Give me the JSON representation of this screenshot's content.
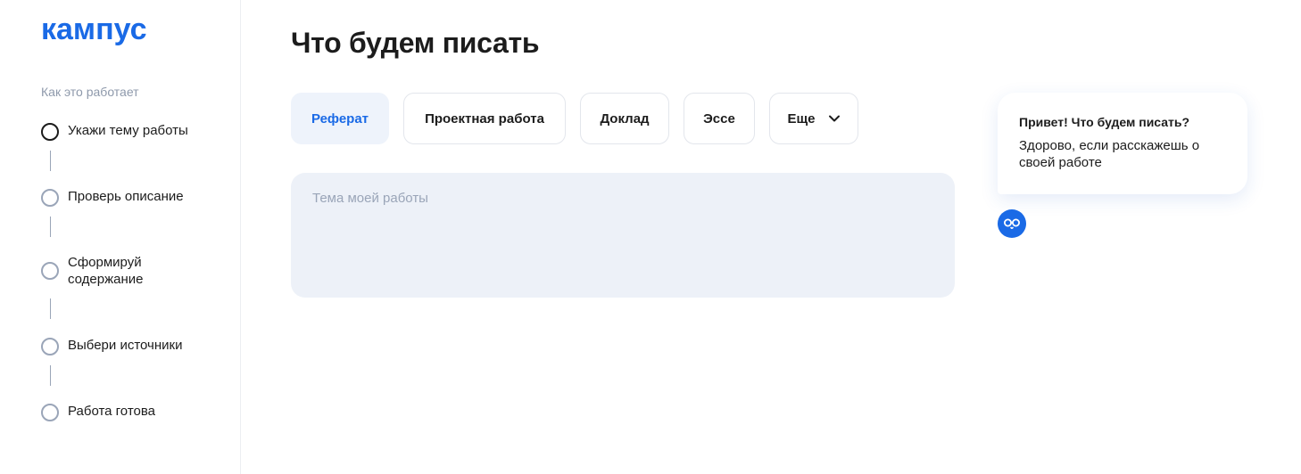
{
  "brand": {
    "logo_text": "кампус",
    "accent": "#1a6ae6"
  },
  "sidebar": {
    "section_label": "Как это работает",
    "steps": [
      {
        "label": "Укажи тему работы",
        "state": "active"
      },
      {
        "label": "Проверь описание",
        "state": "pending"
      },
      {
        "label": "Сформируй содержание",
        "state": "pending"
      },
      {
        "label": "Выбери источники",
        "state": "pending"
      },
      {
        "label": "Работа готова",
        "state": "pending"
      }
    ]
  },
  "main": {
    "title": "Что будем писать",
    "work_types": [
      {
        "label": "Реферат",
        "selected": true
      },
      {
        "label": "Проектная работа",
        "selected": false
      },
      {
        "label": "Доклад",
        "selected": false
      },
      {
        "label": "Эссе",
        "selected": false
      },
      {
        "label": "Еще",
        "selected": false,
        "icon": "chevron-down-icon"
      }
    ],
    "topic_input": {
      "placeholder": "Тема моей работы",
      "value": ""
    }
  },
  "assistant": {
    "greeting_title": "Привет! Что будем писать?",
    "greeting_text": "Здорово, если расскажешь о своей работе",
    "avatar_icon": "bot-glasses-icon"
  }
}
